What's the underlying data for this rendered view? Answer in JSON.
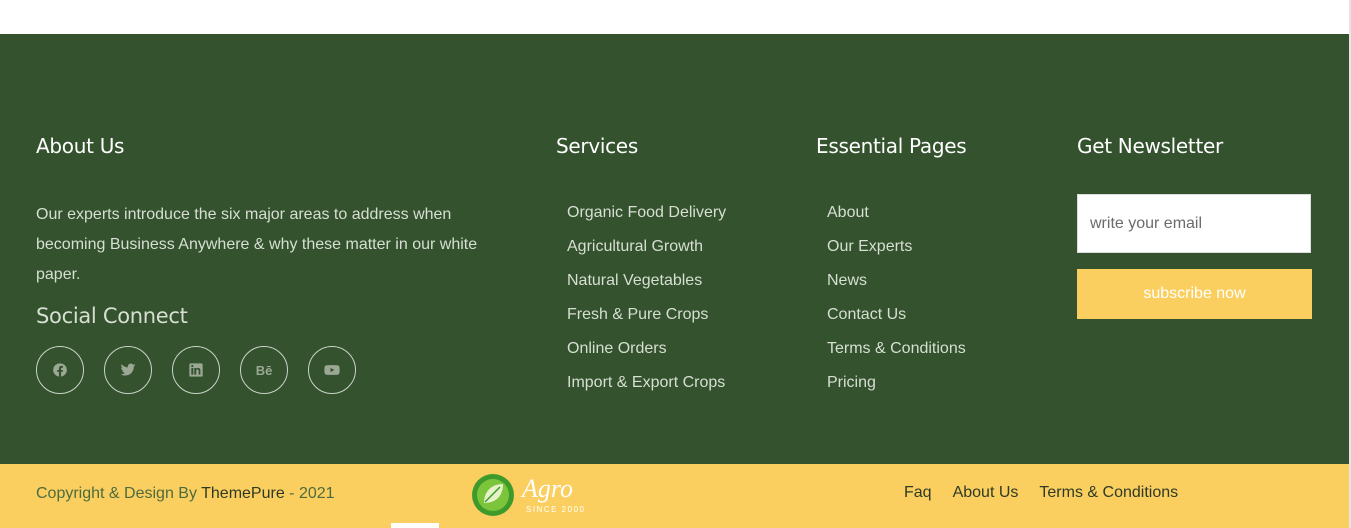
{
  "about": {
    "title": "About Us",
    "text": "Our experts introduce the six major areas to address when becoming Business Anywhere & why these matter in our white paper.",
    "social_title": "Social Connect",
    "social_icons": [
      "facebook-icon",
      "twitter-icon",
      "linkedin-icon",
      "behance-icon",
      "youtube-icon"
    ],
    "behance_glyph": "Bē"
  },
  "services": {
    "title": "Services",
    "items": [
      "Organic Food Delivery",
      "Agricultural Growth",
      "Natural Vegetables",
      "Fresh & Pure Crops",
      "Online Orders",
      "Import & Export Crops"
    ]
  },
  "pages": {
    "title": "Essential Pages",
    "items": [
      "About",
      "Our Experts",
      "News",
      "Contact Us",
      "Terms & Conditions",
      "Pricing"
    ]
  },
  "newsletter": {
    "title": "Get Newsletter",
    "placeholder": "write your email",
    "value": "",
    "button_label": "subscribe now"
  },
  "bottom": {
    "copyright_prefix": "Copyright & Design By ",
    "brand": "ThemePure",
    "year": " - 2021",
    "logo_text": "Agro",
    "logo_sub": "SINCE 2000",
    "links": [
      "Faq",
      "About Us",
      "Terms & Conditions"
    ]
  },
  "colors": {
    "footer_bg": "#33522d",
    "accent": "#fbcf5f"
  }
}
